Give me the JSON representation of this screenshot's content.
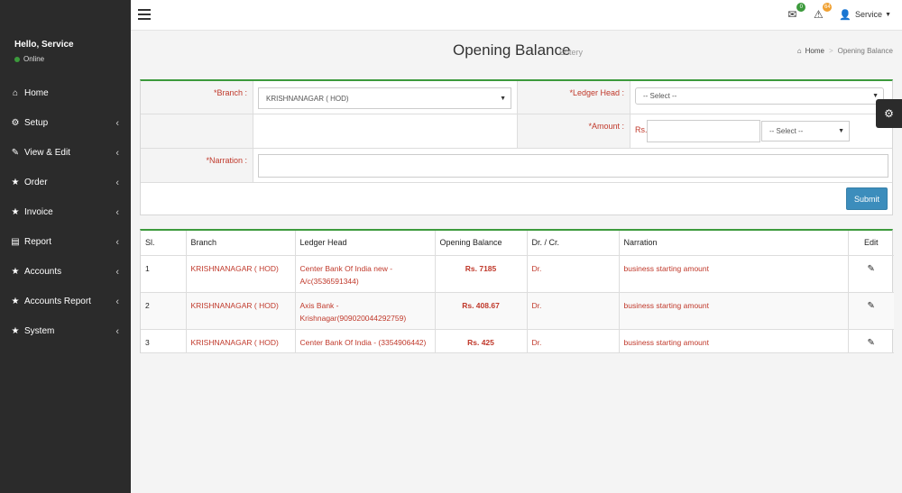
{
  "sidebar": {
    "greeting": "Hello, Service",
    "status": "Online",
    "items": [
      {
        "label": "Home",
        "icon": "home-icon",
        "glyph": "⌂",
        "has_children": false
      },
      {
        "label": "Setup",
        "icon": "cogs-icon",
        "glyph": "⚙",
        "has_children": true
      },
      {
        "label": "View & Edit",
        "icon": "edit-icon",
        "glyph": "✎",
        "has_children": true
      },
      {
        "label": "Order",
        "icon": "star-icon",
        "glyph": "★",
        "has_children": true
      },
      {
        "label": "Invoice",
        "icon": "star-icon",
        "glyph": "★",
        "has_children": true
      },
      {
        "label": "Report",
        "icon": "file-icon",
        "glyph": "▤",
        "has_children": true
      },
      {
        "label": "Accounts",
        "icon": "star-icon",
        "glyph": "★",
        "has_children": true
      },
      {
        "label": "Accounts Report",
        "icon": "star-icon",
        "glyph": "★",
        "has_children": true
      },
      {
        "label": "System",
        "icon": "star-icon",
        "glyph": "★",
        "has_children": true
      }
    ]
  },
  "topbar": {
    "mail_count": "0",
    "alert_count": "64",
    "user": "Service"
  },
  "header": {
    "title": "Opening Balance",
    "subtitle": "Entery",
    "breadcrumb_home": "Home",
    "breadcrumb_current": "Opening Balance"
  },
  "form": {
    "branch_label": "*Branch :",
    "branch_value": "KRISHNANAGAR ( HOD)",
    "ledger_label": "*Ledger Head :",
    "ledger_value": "-- Select --",
    "amount_label": "*Amount :",
    "amount_prefix": "Rs.",
    "amount_value": "",
    "drcr_value": "-- Select --",
    "narration_label": "*Narration :",
    "narration_value": "",
    "submit_label": "Submit"
  },
  "table": {
    "headers": [
      "Sl.",
      "Branch",
      "Ledger Head",
      "Opening Balance",
      "Dr. / Cr.",
      "Narration",
      "Edit"
    ],
    "rows": [
      {
        "sl": "1",
        "branch": "KRISHNANAGAR ( HOD)",
        "ledger": "Center Bank Of India new - A/c(3536591344)",
        "balance": "Rs. 7185",
        "drcr": "Dr.",
        "narration": "business starting amount"
      },
      {
        "sl": "2",
        "branch": "KRISHNANAGAR ( HOD)",
        "ledger": "Axis Bank - Krishnagar(909020044292759)",
        "balance": "Rs. 408.67",
        "drcr": "Dr.",
        "narration": "business starting amount"
      },
      {
        "sl": "3",
        "branch": "KRISHNANAGAR ( HOD)",
        "ledger": "Center Bank Of India - (3354906442)",
        "balance": "Rs. 425",
        "drcr": "Dr.",
        "narration": "business starting amount"
      }
    ]
  }
}
